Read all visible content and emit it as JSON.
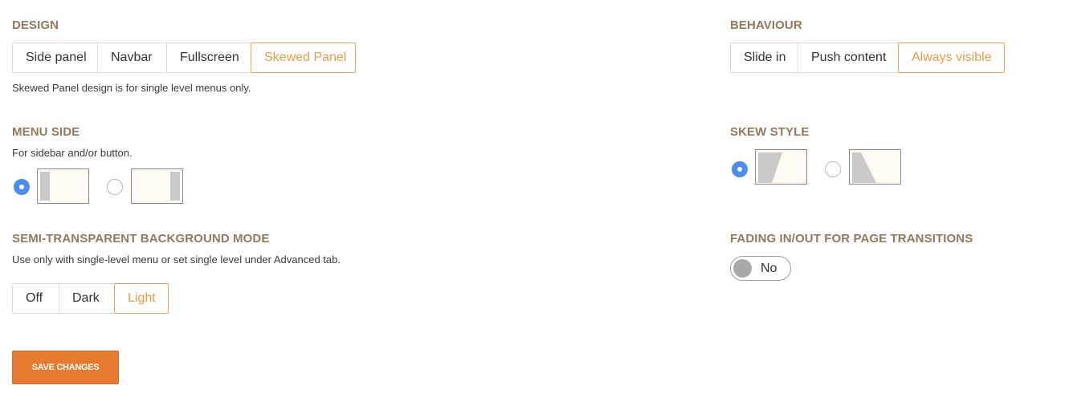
{
  "design": {
    "title": "DESIGN",
    "options": [
      "Side panel",
      "Navbar",
      "Fullscreen",
      "Skewed Panel"
    ],
    "selected": "Skewed Panel",
    "note": "Skewed Panel design is for single level menus only."
  },
  "behaviour": {
    "title": "BEHAVIOUR",
    "options": [
      "Slide in",
      "Push content",
      "Always visible"
    ],
    "selected": "Always visible"
  },
  "menu_side": {
    "title": "MENU SIDE",
    "description": "For sidebar and/or button.",
    "options": [
      "left-panel-icon",
      "right-panel-icon"
    ],
    "selected_index": 0
  },
  "skew_style": {
    "title": "SKEW STYLE",
    "options": [
      "skew-right-icon",
      "skew-left-icon"
    ],
    "selected_index": 0
  },
  "semi_transparent": {
    "title": "SEMI-TRANSPARENT BACKGROUND MODE",
    "description": "Use only with single-level menu or set single level under Advanced tab.",
    "options": [
      "Off",
      "Dark",
      "Light"
    ],
    "selected": "Light"
  },
  "fading": {
    "title": "FADING IN/OUT FOR PAGE TRANSITIONS",
    "toggle_label": "No",
    "enabled": false
  },
  "save_label": "SAVE CHANGES",
  "colors": {
    "heading": "#8f7a5e",
    "accent": "#ee9a4a",
    "radio_checked": "#4a8ff0",
    "save_button": "#e67a2e"
  }
}
